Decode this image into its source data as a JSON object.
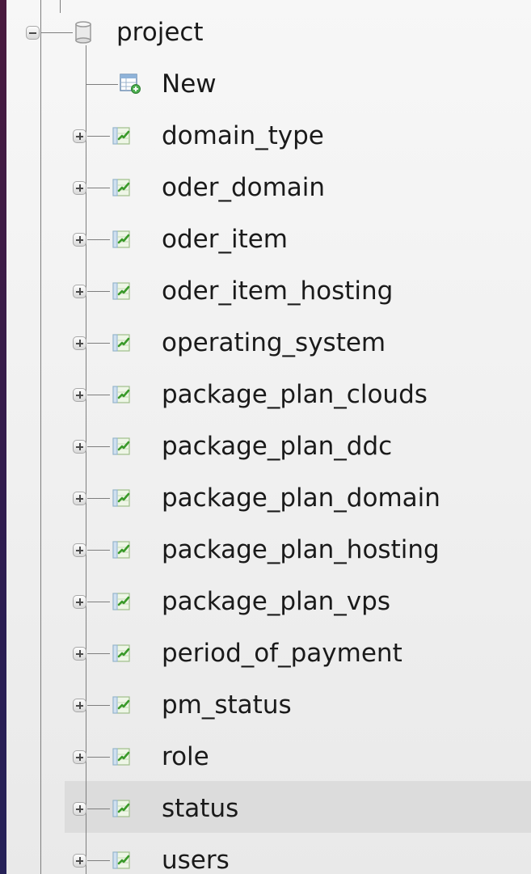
{
  "tree": {
    "database": {
      "label": "project",
      "icon": "database-icon",
      "expanded": true
    },
    "new_item": {
      "label": "New",
      "icon": "new-table-icon"
    },
    "tables": [
      {
        "label": "domain_type",
        "icon": "table-icon"
      },
      {
        "label": "oder_domain",
        "icon": "table-icon"
      },
      {
        "label": "oder_item",
        "icon": "table-icon"
      },
      {
        "label": "oder_item_hosting",
        "icon": "table-icon"
      },
      {
        "label": "operating_system",
        "icon": "table-icon"
      },
      {
        "label": "package_plan_clouds",
        "icon": "table-icon"
      },
      {
        "label": "package_plan_ddc",
        "icon": "table-icon"
      },
      {
        "label": "package_plan_domain",
        "icon": "table-icon"
      },
      {
        "label": "package_plan_hosting",
        "icon": "table-icon"
      },
      {
        "label": "package_plan_vps",
        "icon": "table-icon"
      },
      {
        "label": "period_of_payment",
        "icon": "table-icon"
      },
      {
        "label": "pm_status",
        "icon": "table-icon"
      },
      {
        "label": "role",
        "icon": "table-icon"
      },
      {
        "label": "status",
        "icon": "table-icon",
        "hovered": true
      },
      {
        "label": "users",
        "icon": "table-icon"
      }
    ]
  },
  "colors": {
    "line": "#7e7e7e",
    "text": "#1a1a1a",
    "hover": "#dcdcdc"
  }
}
